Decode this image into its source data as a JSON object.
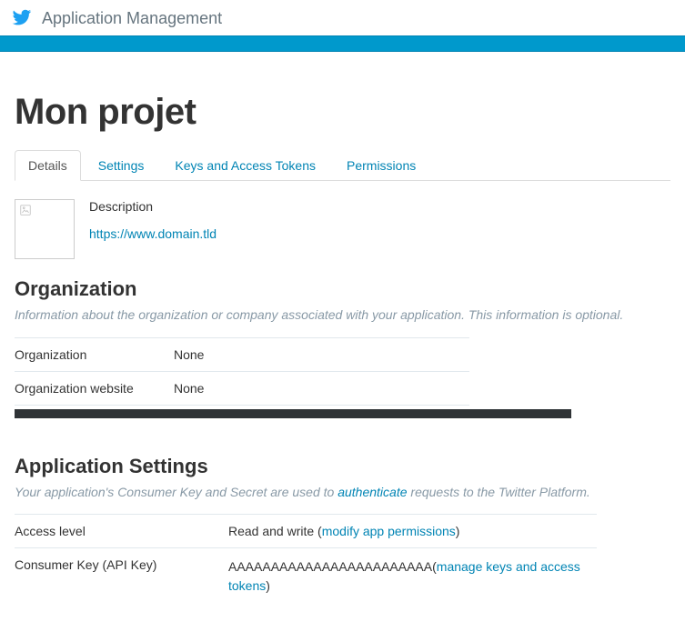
{
  "header": {
    "brand_label": "Application Management"
  },
  "app": {
    "title": "Mon projet"
  },
  "tabs": [
    {
      "label": "Details",
      "active": true
    },
    {
      "label": "Settings",
      "active": false
    },
    {
      "label": "Keys and Access Tokens",
      "active": false
    },
    {
      "label": "Permissions",
      "active": false
    }
  ],
  "description": {
    "label": "Description",
    "domain_url": "https://www.domain.tld"
  },
  "organization": {
    "title": "Organization",
    "subtitle": "Information about the organization or company associated with your application. This information is optional.",
    "rows": [
      {
        "key": "Organization",
        "value": "None"
      },
      {
        "key": "Organization website",
        "value": "None"
      }
    ]
  },
  "app_settings": {
    "title": "Application Settings",
    "sub_prefix": "Your application's Consumer Key and Secret are used to ",
    "sub_link": "authenticate",
    "sub_suffix": " requests to the Twitter Platform.",
    "access_level": {
      "key": "Access level",
      "value": "Read and write (",
      "link": "modify app permissions",
      "suffix": ")"
    },
    "consumer_key": {
      "key": "Consumer Key (API Key)",
      "value": "AAAAAAAAAAAAAAAAAAAAAAAA(",
      "link": "manage keys and access tokens",
      "suffix": ")"
    }
  }
}
